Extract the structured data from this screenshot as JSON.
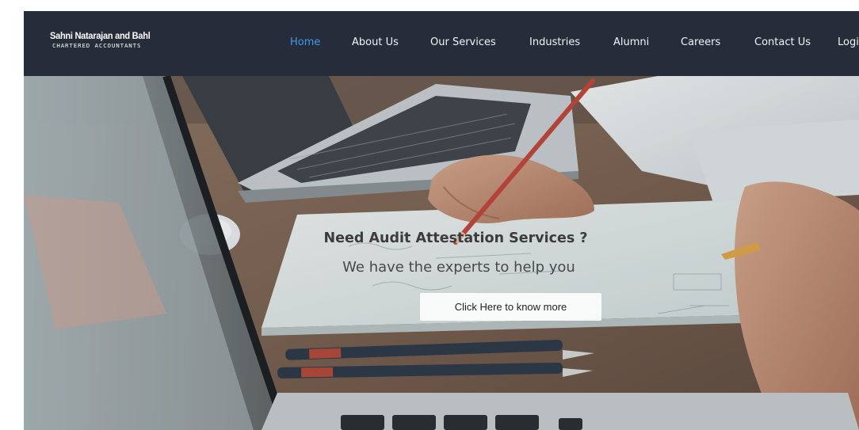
{
  "brand": {
    "name": "Sahni Natarajan and Bahl",
    "tagline": "CHARTERED ACCOUNTANTS"
  },
  "nav": {
    "items": [
      {
        "label": "Home",
        "active": true
      },
      {
        "label": "About Us",
        "active": false
      },
      {
        "label": "Our Services",
        "active": false
      },
      {
        "label": "Industries",
        "active": false
      },
      {
        "label": "Alumni",
        "active": false
      },
      {
        "label": "Careers",
        "active": false
      },
      {
        "label": "Contact Us",
        "active": false
      },
      {
        "label": "Logi",
        "active": false
      }
    ]
  },
  "hero": {
    "title": "Need Audit Attestation Services ?",
    "subtitle": "We have the experts to help you",
    "cta_label": "Click Here to know more"
  },
  "colors": {
    "navbar_bg": "#262c3a",
    "nav_text": "#f2f3f5",
    "nav_active": "#3b9bf0",
    "hero_title": "#3d3b3c"
  }
}
